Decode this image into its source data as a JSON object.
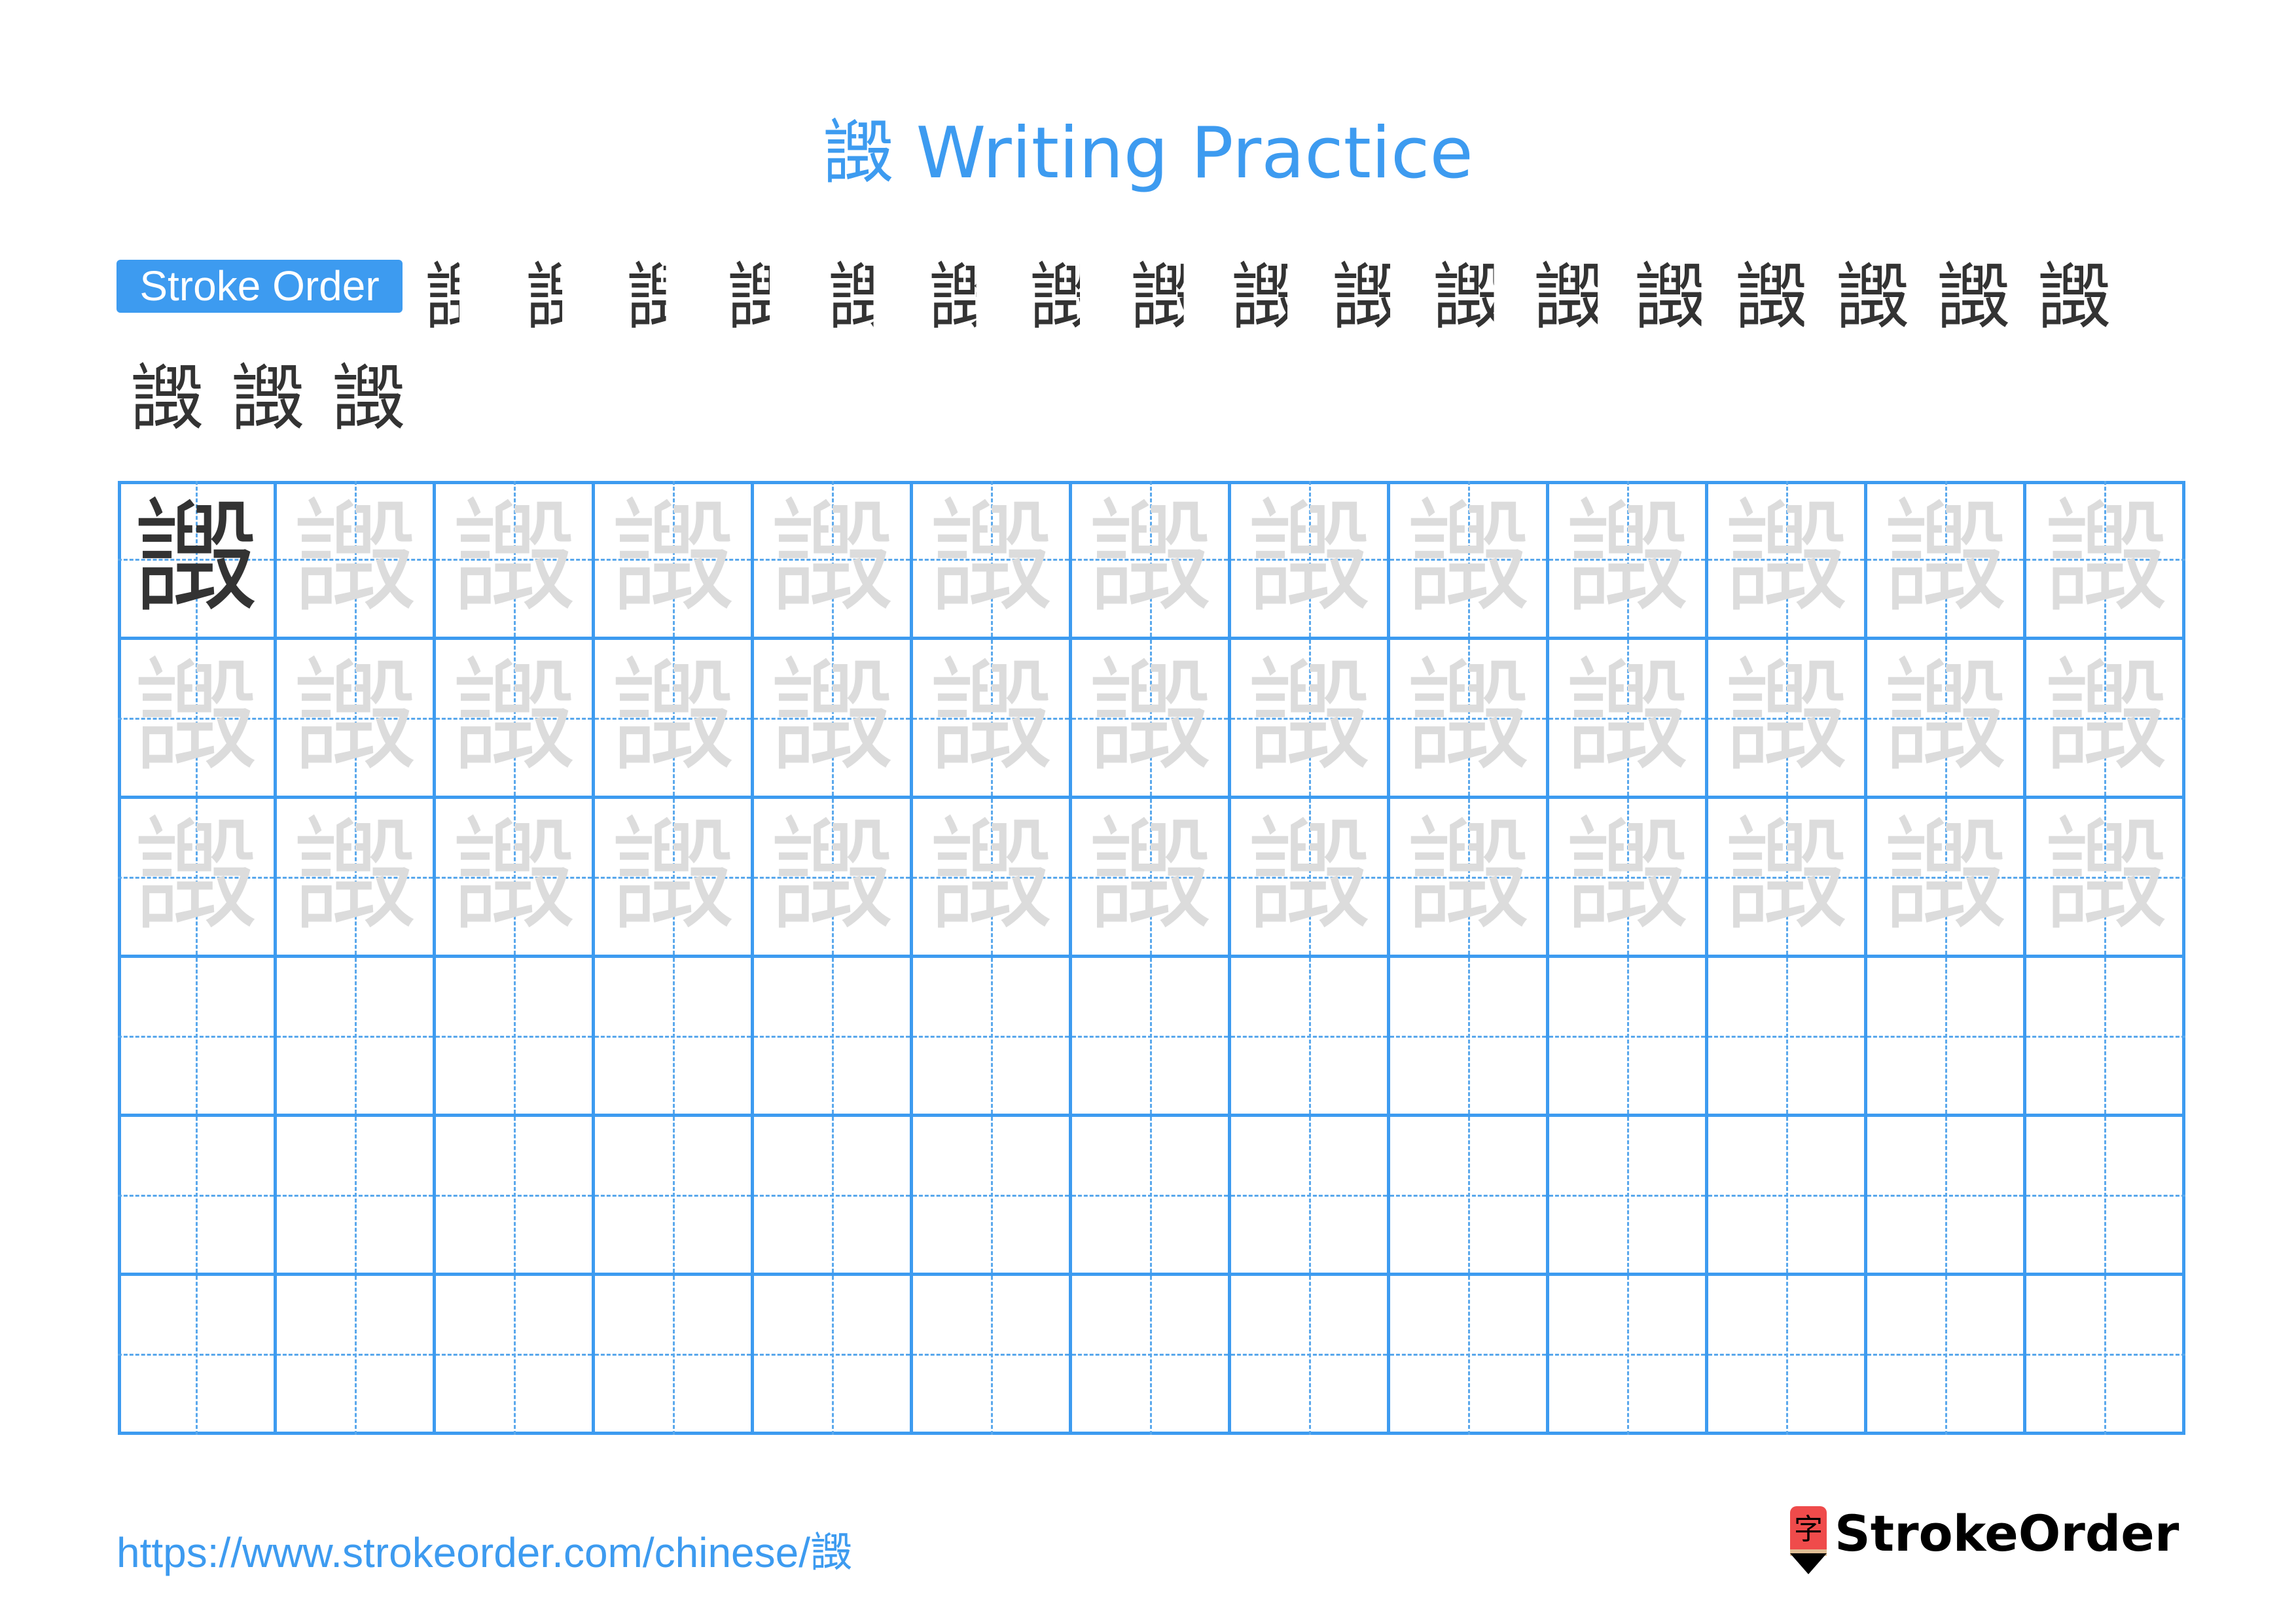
{
  "title": "譭 Writing Practice",
  "character": "譭",
  "stroke_order": {
    "label": "Stroke Order",
    "total_strokes": 20,
    "steps": [
      {
        "step": 1
      },
      {
        "step": 2
      },
      {
        "step": 3
      },
      {
        "step": 4
      },
      {
        "step": 5
      },
      {
        "step": 6
      },
      {
        "step": 7
      },
      {
        "step": 8
      },
      {
        "step": 9
      },
      {
        "step": 10
      },
      {
        "step": 11
      },
      {
        "step": 12
      },
      {
        "step": 13
      },
      {
        "step": 14
      },
      {
        "step": 15
      },
      {
        "step": 16
      },
      {
        "step": 17
      },
      {
        "step": 18
      },
      {
        "step": 19
      },
      {
        "step": 20
      }
    ],
    "highlight_color": "#ff0000",
    "ink_color": "#333333"
  },
  "practice_grid": {
    "rows": 6,
    "columns": 13,
    "model_cells": 1,
    "trace_rows": 3,
    "blank_rows": 3,
    "line_color": "#3d9bf0",
    "trace_color": "#dcdcdc"
  },
  "footer": {
    "url": "https://www.strokeorder.com/chinese/譭",
    "logo_icon_char": "字",
    "logo_text": "StrokeOrder"
  },
  "colors": {
    "accent": "#3d9bf0",
    "logo_red": "#ef4b4b"
  }
}
